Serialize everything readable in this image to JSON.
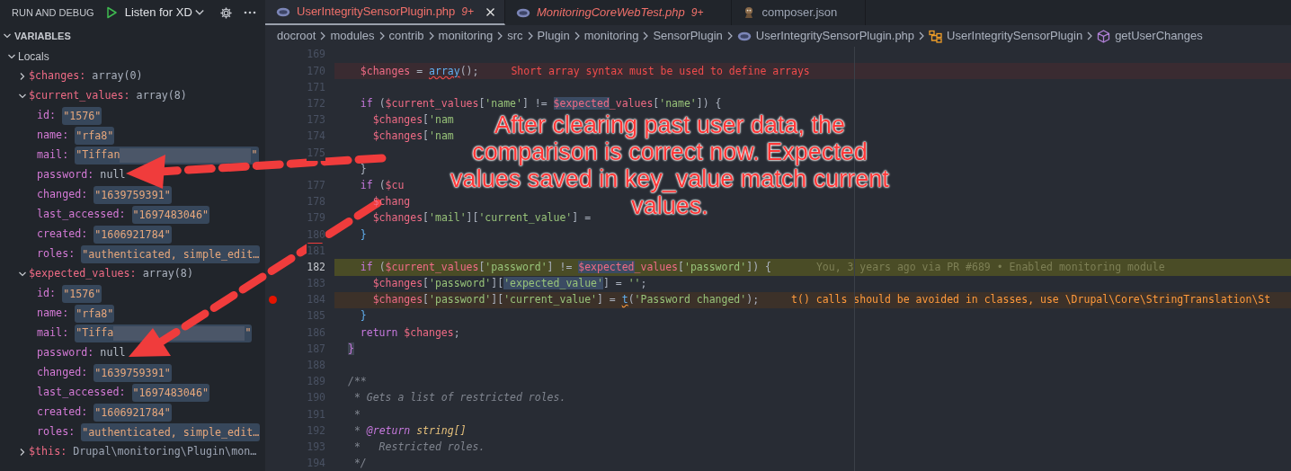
{
  "debug_header": {
    "title": "RUN AND DEBUG",
    "configuration": "Listen for XD"
  },
  "variables": {
    "title": "VARIABLES",
    "expanded": true,
    "scopes": [
      {
        "name": "Locals",
        "expanded": true,
        "children": [
          {
            "name": "$changes:",
            "value": "array(0)",
            "kind": "array",
            "expanded": false
          },
          {
            "name": "$current_values:",
            "value": "array(8)",
            "kind": "array",
            "expanded": true,
            "children": [
              {
                "name": "id:",
                "value": "\"1576\"",
                "kind": "string"
              },
              {
                "name": "name:",
                "value": "\"rfa8\"",
                "kind": "string"
              },
              {
                "name": "mail:",
                "value": "\"Tiffan",
                "value_end": "\"",
                "kind": "redacted"
              },
              {
                "name": "password:",
                "value": "null",
                "kind": "null"
              },
              {
                "name": "changed:",
                "value": "\"1639759391\"",
                "kind": "string"
              },
              {
                "name": "last_accessed:",
                "value": "\"1697483046\"",
                "kind": "string"
              },
              {
                "name": "created:",
                "value": "\"1606921784\"",
                "kind": "string"
              },
              {
                "name": "roles:",
                "value": "\"authenticated, simple_edit…",
                "kind": "string"
              }
            ]
          },
          {
            "name": "$expected_values:",
            "value": "array(8)",
            "kind": "array",
            "expanded": true,
            "children": [
              {
                "name": "id:",
                "value": "\"1576\"",
                "kind": "string"
              },
              {
                "name": "name:",
                "value": "\"rfa8\"",
                "kind": "string"
              },
              {
                "name": "mail:",
                "value": "\"Tiffa",
                "value_end": "\"",
                "kind": "redacted"
              },
              {
                "name": "password:",
                "value": "null",
                "kind": "null"
              },
              {
                "name": "changed:",
                "value": "\"1639759391\"",
                "kind": "string"
              },
              {
                "name": "last_accessed:",
                "value": "\"1697483046\"",
                "kind": "string"
              },
              {
                "name": "created:",
                "value": "\"1606921784\"",
                "kind": "string"
              },
              {
                "name": "roles:",
                "value": "\"authenticated, simple_edit…",
                "kind": "string"
              }
            ]
          },
          {
            "name": "$this:",
            "value": "Drupal\\monitoring\\Plugin\\mon…",
            "kind": "object",
            "expanded": false
          }
        ]
      }
    ]
  },
  "tabs": [
    {
      "label": "UserIntegritySensorPlugin.php",
      "badge": "9+",
      "kind": "php",
      "selected": true,
      "preview": false,
      "has_problems": true
    },
    {
      "label": "MonitoringCoreWebTest.php",
      "badge": "9+",
      "kind": "php",
      "selected": false,
      "preview": true,
      "has_problems": true
    },
    {
      "label": "composer.json",
      "kind": "composer",
      "selected": false,
      "preview": false,
      "has_problems": false
    }
  ],
  "breadcrumbs": [
    {
      "label": "docroot",
      "kind": "folder"
    },
    {
      "label": "modules",
      "kind": "folder"
    },
    {
      "label": "contrib",
      "kind": "folder"
    },
    {
      "label": "monitoring",
      "kind": "folder"
    },
    {
      "label": "src",
      "kind": "folder"
    },
    {
      "label": "Plugin",
      "kind": "folder"
    },
    {
      "label": "monitoring",
      "kind": "folder"
    },
    {
      "label": "SensorPlugin",
      "kind": "folder"
    },
    {
      "label": "UserIntegritySensorPlugin.php",
      "kind": "php"
    },
    {
      "label": "UserIntegritySensorPlugin",
      "kind": "class"
    },
    {
      "label": "getUserChanges",
      "kind": "method"
    }
  ],
  "editor": {
    "lines": [
      {
        "number": "169"
      },
      {
        "number": "170",
        "error": true,
        "tokens": [
          {
            "text": "  $changes",
            "kind": "var"
          },
          {
            "text": " = "
          },
          {
            "text": "array",
            "kind": "fn",
            "squiggle": true
          },
          {
            "text": "();"
          }
        ],
        "diagnostic": {
          "text": "Short array syntax must be used to define arrays",
          "kind": "error"
        }
      },
      {
        "number": "171"
      },
      {
        "number": "172",
        "tokens": [
          {
            "text": "  if",
            "kind": "kw"
          },
          {
            "text": " ("
          },
          {
            "text": "$current_values",
            "kind": "var"
          },
          {
            "text": "["
          },
          {
            "text": "'name'",
            "kind": "str"
          },
          {
            "text": "] != "
          },
          {
            "text": "$expected",
            "kind": "var",
            "occurrence": true
          },
          {
            "text": "_values",
            "kind": "var"
          },
          {
            "text": "["
          },
          {
            "text": "'name'",
            "kind": "str"
          },
          {
            "text": "]) {"
          }
        ]
      },
      {
        "number": "173",
        "tokens": [
          {
            "text": "    $changes",
            "kind": "var"
          },
          {
            "text": "["
          },
          {
            "text": "'nam",
            "kind": "str"
          }
        ]
      },
      {
        "number": "174",
        "tokens": [
          {
            "text": "    $changes",
            "kind": "var"
          },
          {
            "text": "["
          },
          {
            "text": "'nam",
            "kind": "str"
          }
        ]
      },
      {
        "number": "175"
      },
      {
        "tokens": [
          {
            "text": "  }"
          }
        ]
      },
      {
        "number": "177",
        "tokens": [
          {
            "text": "  if",
            "kind": "kw"
          },
          {
            "text": " ("
          },
          {
            "text": "$cu",
            "kind": "var"
          }
        ]
      },
      {
        "number": "178",
        "tokens": [
          {
            "text": "    $chang",
            "kind": "var"
          }
        ]
      },
      {
        "number": "179",
        "tokens": [
          {
            "text": "    $changes",
            "kind": "var"
          },
          {
            "text": "["
          },
          {
            "text": "'mail'",
            "kind": "str"
          },
          {
            "text": "]["
          },
          {
            "text": "'current_value'",
            "kind": "str"
          },
          {
            "text": "] ="
          }
        ]
      },
      {
        "number": "180",
        "tokens": [
          {
            "text": "  }",
            "kind": "bracket"
          }
        ]
      },
      {
        "number": "181"
      },
      {
        "number": "182",
        "current": true,
        "tokens": [
          {
            "text": "  if",
            "kind": "kw"
          },
          {
            "text": " ("
          },
          {
            "text": "$current_values",
            "kind": "var"
          },
          {
            "text": "["
          },
          {
            "text": "'password'",
            "kind": "str"
          },
          {
            "text": "] != "
          },
          {
            "text": "$expected",
            "kind": "var",
            "occurrence": true
          },
          {
            "text": "_values",
            "kind": "var"
          },
          {
            "text": "["
          },
          {
            "text": "'password'",
            "kind": "str"
          },
          {
            "text": "]) {"
          }
        ],
        "blame": "You, 3 years ago via PR #689 • Enabled monitoring module"
      },
      {
        "number": "183",
        "tokens": [
          {
            "text": "    $changes",
            "kind": "var"
          },
          {
            "text": "["
          },
          {
            "text": "'password'",
            "kind": "str"
          },
          {
            "text": "]["
          },
          {
            "text": "'expected_value'",
            "kind": "str",
            "occurrence": true
          },
          {
            "text": "] = "
          },
          {
            "text": "''",
            "kind": "str"
          },
          {
            "text": ";"
          }
        ]
      },
      {
        "number": "184",
        "warning": true,
        "breakpoint": true,
        "tokens": [
          {
            "text": "    $changes",
            "kind": "var"
          },
          {
            "text": "["
          },
          {
            "text": "'password'",
            "kind": "str"
          },
          {
            "text": "]["
          },
          {
            "text": "'current_value'",
            "kind": "str"
          },
          {
            "text": "] = "
          },
          {
            "text": "t",
            "kind": "fn",
            "squiggle": true
          },
          {
            "text": "("
          },
          {
            "text": "'Password changed'",
            "kind": "str"
          },
          {
            "text": ");"
          }
        ],
        "diagnostic": {
          "text": "t() calls should be avoided in classes, use \\Drupal\\Core\\StringTranslation\\St",
          "kind": "warning"
        }
      },
      {
        "number": "185",
        "tokens": [
          {
            "text": "  }",
            "kind": "bracket"
          }
        ]
      },
      {
        "number": "186",
        "tokens": [
          {
            "text": "  return",
            "kind": "kw"
          },
          {
            "text": " $changes",
            "kind": "var"
          },
          {
            "text": ";"
          }
        ]
      },
      {
        "number": "187",
        "tokens": [
          {
            "text": "}",
            "kind": "bracket2"
          }
        ]
      },
      {
        "number": "188"
      },
      {
        "number": "189",
        "tokens": [
          {
            "text": "/**",
            "kind": "comment"
          }
        ]
      },
      {
        "number": "190",
        "tokens": [
          {
            "text": " * Gets a list of restricted roles.",
            "kind": "comment"
          }
        ]
      },
      {
        "number": "191",
        "tokens": [
          {
            "text": " *",
            "kind": "comment"
          }
        ]
      },
      {
        "number": "192",
        "tokens": [
          {
            "text": " * ",
            "kind": "comment"
          },
          {
            "text": "@return",
            "kind": "doctag"
          },
          {
            "text": " string[]",
            "kind": "type"
          }
        ]
      },
      {
        "number": "193",
        "tokens": [
          {
            "text": " *   Restricted roles.",
            "kind": "comment"
          }
        ]
      },
      {
        "number": "194",
        "tokens": [
          {
            "text": " */",
            "kind": "comment"
          }
        ]
      }
    ]
  },
  "annotation": {
    "lines": [
      "After clearing past user data, the",
      "comparison is correct now. Expected",
      "values saved in key_value match current",
      "values."
    ]
  }
}
